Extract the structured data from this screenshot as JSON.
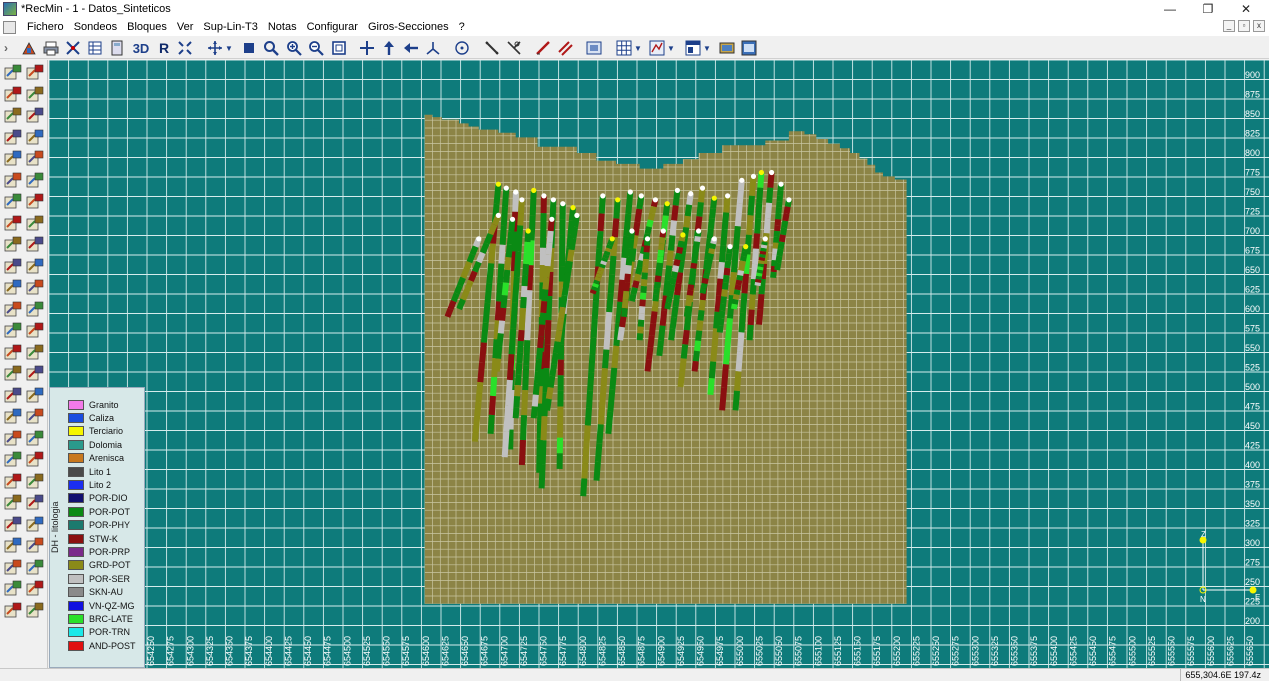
{
  "window": {
    "title": "*RecMin - 1 - Datos_Sinteticos",
    "min_glyph": "—",
    "max_glyph": "❐",
    "close_glyph": "✕"
  },
  "menu": [
    "Fichero",
    "Sondeos",
    "Bloques",
    "Ver",
    "Sup-Lin-T3",
    "Notas",
    "Configurar",
    "Giros-Secciones",
    "?"
  ],
  "mdi": [
    "_",
    "▫",
    "x"
  ],
  "toolbar_labels": [
    "3D",
    "R"
  ],
  "canvas": {
    "background": "#0e7b7b",
    "grid_color": "#d4ecec",
    "block_color": "#8c8446",
    "block_grid_color": "#c9c6a2"
  },
  "y_axis": [
    "900",
    "875",
    "850",
    "825",
    "800",
    "775",
    "750",
    "725",
    "700",
    "675",
    "650",
    "625",
    "600",
    "575",
    "550",
    "525",
    "500",
    "475",
    "450",
    "425",
    "400",
    "375",
    "350",
    "325",
    "300",
    "275",
    "250",
    "225",
    "200"
  ],
  "x_axis": [
    "654250",
    "654275",
    "654300",
    "654325",
    "654350",
    "654375",
    "654400",
    "654425",
    "654450",
    "654475",
    "654500",
    "654525",
    "654550",
    "654575",
    "654600",
    "654625",
    "654650",
    "654675",
    "654700",
    "654725",
    "654750",
    "654775",
    "654800",
    "654825",
    "654850",
    "654875",
    "654900",
    "654925",
    "654950",
    "654975",
    "655000",
    "655025",
    "655050",
    "655075",
    "655100",
    "655125",
    "655150",
    "655175",
    "655200",
    "655225",
    "655250",
    "655275",
    "655300",
    "655325",
    "655350",
    "655375",
    "655400",
    "655425",
    "655450",
    "655475",
    "655500",
    "655525",
    "655550",
    "655575",
    "655600",
    "655625",
    "655650"
  ],
  "axis_glyph": {
    "z": "Z",
    "e": "E",
    "n": "N"
  },
  "legend": {
    "title": "DH - litologia",
    "items": [
      {
        "label": "Granito",
        "color": "#f27ae8"
      },
      {
        "label": "Caliza",
        "color": "#1a4de0"
      },
      {
        "label": "Terciario",
        "color": "#f6f600"
      },
      {
        "label": "Dolomia",
        "color": "#2a9a8c"
      },
      {
        "label": "Arenisca",
        "color": "#c8781e"
      },
      {
        "label": "Lito 1",
        "color": "#4a4a4a"
      },
      {
        "label": "Lito 2",
        "color": "#1a2ef0"
      },
      {
        "label": "POR-DIO",
        "color": "#101070"
      },
      {
        "label": "POR-POT",
        "color": "#0a8a14"
      },
      {
        "label": "POR-PHY",
        "color": "#1b7a6e"
      },
      {
        "label": "STW-K",
        "color": "#8a1010"
      },
      {
        "label": "POR-PRP",
        "color": "#7a2a8a"
      },
      {
        "label": "GRD-POT",
        "color": "#8a8a18"
      },
      {
        "label": "POR-SER",
        "color": "#c0c0c0"
      },
      {
        "label": "SKN-AU",
        "color": "#8a8a8a"
      },
      {
        "label": "VN-QZ-MG",
        "color": "#1010e0"
      },
      {
        "label": "BRC-LATE",
        "color": "#2ae02a"
      },
      {
        "label": "POR-TRN",
        "color": "#1ae8e8"
      },
      {
        "label": "AND-POST",
        "color": "#e01010"
      }
    ]
  },
  "status": {
    "coords": "655,304.6E 197.4z"
  }
}
